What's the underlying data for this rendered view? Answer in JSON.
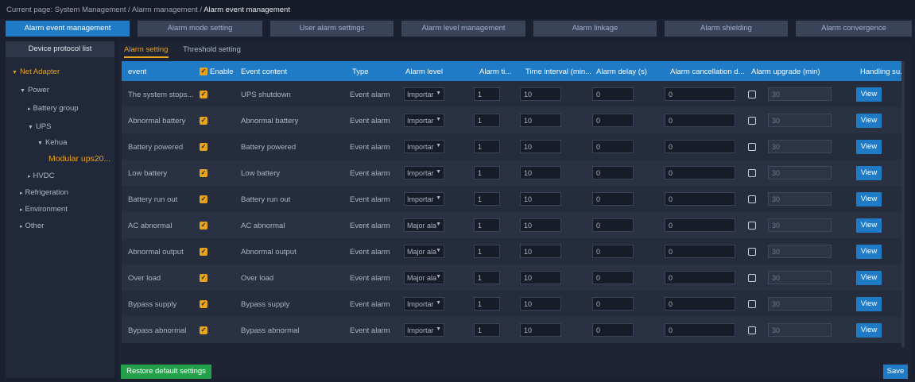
{
  "breadcrumb": {
    "prefix": "Current page: System Management / Alarm management / ",
    "current": "Alarm event management"
  },
  "top_tabs": [
    {
      "label": "Alarm event management",
      "active": true
    },
    {
      "label": "Alarm mode setting",
      "active": false
    },
    {
      "label": "User alarm settings",
      "active": false
    },
    {
      "label": "Alarm level management",
      "active": false
    },
    {
      "label": "Alarm linkage",
      "active": false
    },
    {
      "label": "Alarm shielding",
      "active": false
    },
    {
      "label": "Alarm convergence",
      "active": false
    }
  ],
  "sidebar": {
    "title": "Device protocol list",
    "tree": [
      {
        "label": "Net Adapter",
        "arrow": "▼"
      },
      {
        "label": "Power",
        "arrow": "▼"
      },
      {
        "label": "Battery group",
        "arrow": "▸"
      },
      {
        "label": "UPS",
        "arrow": "▼"
      },
      {
        "label": "Kehua",
        "arrow": "▼"
      },
      {
        "label": "Modular ups20...",
        "arrow": ""
      },
      {
        "label": "HVDC",
        "arrow": "▸"
      },
      {
        "label": "Refrigeration",
        "arrow": "▸"
      },
      {
        "label": "Environment",
        "arrow": "▸"
      },
      {
        "label": "Other",
        "arrow": "▸"
      }
    ]
  },
  "subtabs": {
    "alarm_setting": "Alarm setting",
    "threshold_setting": "Threshold setting"
  },
  "table": {
    "headers": {
      "event": "event",
      "enable": "Enable",
      "event_content": "Event content",
      "type": "Type",
      "alarm_level": "Alarm level",
      "alarm_times": "Alarm ti...",
      "time_interval": "Time interval (min...",
      "alarm_delay": "Alarm delay (s)",
      "alarm_cancellation": "Alarm cancellation d...",
      "alarm_upgrade": "Alarm upgrade (min)",
      "handling": "Handling su..."
    },
    "rows": [
      {
        "event": "The system stops...",
        "content": "UPS shutdown",
        "type": "Event alarm",
        "level": "Importar",
        "times": "1",
        "interval": "10",
        "delay": "0",
        "cancel": "0",
        "upgrade": "30",
        "view": "View"
      },
      {
        "event": "Abnormal battery",
        "content": "Abnormal battery",
        "type": "Event alarm",
        "level": "Importar",
        "times": "1",
        "interval": "10",
        "delay": "0",
        "cancel": "0",
        "upgrade": "30",
        "view": "View"
      },
      {
        "event": "Battery powered",
        "content": "Battery powered",
        "type": "Event alarm",
        "level": "Importar",
        "times": "1",
        "interval": "10",
        "delay": "0",
        "cancel": "0",
        "upgrade": "30",
        "view": "View"
      },
      {
        "event": "Low battery",
        "content": "Low battery",
        "type": "Event alarm",
        "level": "Importar",
        "times": "1",
        "interval": "10",
        "delay": "0",
        "cancel": "0",
        "upgrade": "30",
        "view": "View"
      },
      {
        "event": "Battery run out",
        "content": "Battery run out",
        "type": "Event alarm",
        "level": "Importar",
        "times": "1",
        "interval": "10",
        "delay": "0",
        "cancel": "0",
        "upgrade": "30",
        "view": "View"
      },
      {
        "event": "AC abnormal",
        "content": "AC abnormal",
        "type": "Event alarm",
        "level": "Major ala",
        "times": "1",
        "interval": "10",
        "delay": "0",
        "cancel": "0",
        "upgrade": "30",
        "view": "View"
      },
      {
        "event": "Abnormal output",
        "content": "Abnormal output",
        "type": "Event alarm",
        "level": "Major ala",
        "times": "1",
        "interval": "10",
        "delay": "0",
        "cancel": "0",
        "upgrade": "30",
        "view": "View"
      },
      {
        "event": "Over load",
        "content": "Over load",
        "type": "Event alarm",
        "level": "Major ala",
        "times": "1",
        "interval": "10",
        "delay": "0",
        "cancel": "0",
        "upgrade": "30",
        "view": "View"
      },
      {
        "event": "Bypass supply",
        "content": "Bypass supply",
        "type": "Event alarm",
        "level": "Importar",
        "times": "1",
        "interval": "10",
        "delay": "0",
        "cancel": "0",
        "upgrade": "30",
        "view": "View"
      },
      {
        "event": "Bypass abnormal",
        "content": "Bypass abnormal",
        "type": "Event alarm",
        "level": "Importar",
        "times": "1",
        "interval": "10",
        "delay": "0",
        "cancel": "0",
        "upgrade": "30",
        "view": "View"
      }
    ]
  },
  "buttons": {
    "restore": "Restore default settings",
    "save": "Save"
  },
  "colors": {
    "accent_blue": "#1f7bc6",
    "accent_orange": "#e8a31e",
    "green": "#23a04a",
    "background": "#1a2030"
  }
}
